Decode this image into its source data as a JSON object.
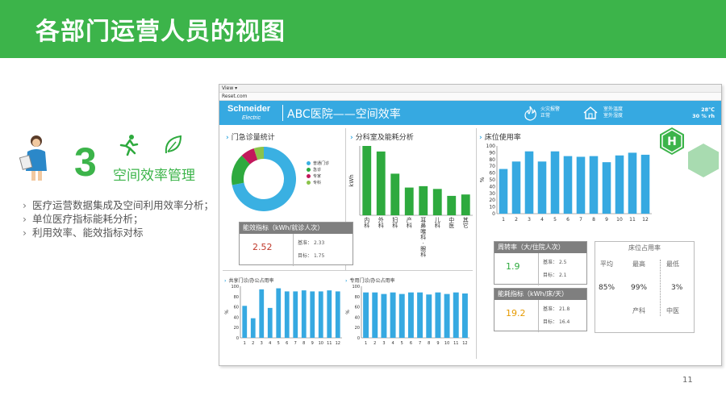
{
  "slide": {
    "title": "各部门运营人员的视图",
    "section_number": "3",
    "section_title": "空间效率管理",
    "bullets": [
      "医疗运营数据集成及空间利用效率分析；",
      "单位医疗指标能耗分析；",
      "利用效率、能效指标对标"
    ],
    "page_number": "11"
  },
  "browser": {
    "menu": "View ▾",
    "url": "Reset.com"
  },
  "app": {
    "logo": "Schneider",
    "logo_sub": "Electric",
    "title": "ABC医院——空间效率",
    "alarm_label": "火灾报警",
    "alarm_status": "正常",
    "indoor_temp_label": "室外温度",
    "indoor_hum_label": "室外湿度",
    "temp_value": "28℃",
    "hum_value": "30 % rh"
  },
  "panels": {
    "outpatient": {
      "title": "门急诊量统计",
      "legend": [
        {
          "label": "普通门诊",
          "color": "#3ab0e2"
        },
        {
          "label": "急诊",
          "color": "#2eaa3e"
        },
        {
          "label": "专家",
          "color": "#c2185b"
        },
        {
          "label": "专科",
          "color": "#8bc34a"
        }
      ],
      "kpi_title": "能效指标（kWh/就诊人次）",
      "kpi_value": "2.52",
      "kpi_base_label": "基准：",
      "kpi_base": "2.33",
      "kpi_target_label": "目标：",
      "kpi_target": "1.75"
    },
    "dept": {
      "title": "分科室及能耗分析"
    },
    "bed": {
      "title": "床位使用率",
      "turnover_title": "周转率（大/住院人次）",
      "turnover_value": "1.9",
      "turnover_base_label": "基准：",
      "turnover_base": "2.5",
      "turnover_target_label": "目标：",
      "turnover_target": "2.1",
      "energy_title": "能耗指标（kWh/床/天）",
      "energy_value": "19.2",
      "energy_base_label": "基准：",
      "energy_base": "21.8",
      "energy_target_label": "目标：",
      "energy_target": "16.4",
      "occ_title": "床位占用率",
      "occ_labels": [
        "平均",
        "最高",
        "最低"
      ],
      "occ_values": [
        "85%",
        "99%",
        "3%"
      ],
      "occ_depts": [
        "产科",
        "中医"
      ],
      "hospital_mark": "H"
    },
    "public": {
      "title": "共享门诊/办公占用率"
    },
    "dedicated": {
      "title": "专用门诊/办公占用率"
    }
  },
  "colors": {
    "banner": "#3cb44a",
    "accent": "#36a9e1",
    "bar_blue": "#36a9e1",
    "bar_green": "#2eaa3e",
    "kpi_red": "#c0392b",
    "kpi_green": "#2eaa3e",
    "kpi_orange": "#e69a00"
  },
  "chart_data": [
    {
      "id": "outpatient",
      "type": "pie",
      "title": "门急诊量统计",
      "categories": [
        "普通门诊",
        "急诊",
        "专家",
        "专科"
      ],
      "values": [
        72,
        16,
        7,
        5
      ]
    },
    {
      "id": "dept",
      "type": "bar",
      "title": "分科室及能耗分析",
      "ylabel": "kWh",
      "categories": [
        "内科",
        "外科",
        "妇科",
        "产科",
        "耳鼻喉科·眼科",
        "儿科",
        "中医",
        "其它"
      ],
      "values": [
        100,
        92,
        60,
        40,
        42,
        38,
        28,
        30
      ],
      "ylim": [
        0,
        100
      ]
    },
    {
      "id": "bed",
      "type": "bar",
      "title": "床位使用率",
      "ylabel": "%",
      "categories": [
        "1",
        "2",
        "3",
        "4",
        "5",
        "6",
        "7",
        "8",
        "9",
        "10",
        "11",
        "12"
      ],
      "values": [
        66,
        77,
        92,
        77,
        92,
        85,
        84,
        85,
        76,
        86,
        90,
        87
      ],
      "ylim": [
        0,
        100
      ],
      "yticks": [
        0,
        10,
        20,
        30,
        40,
        50,
        60,
        70,
        80,
        90,
        100
      ]
    },
    {
      "id": "public",
      "type": "bar",
      "title": "共享门诊/办公占用率",
      "ylabel": "%",
      "categories": [
        "1",
        "2",
        "3",
        "4",
        "5",
        "6",
        "7",
        "8",
        "9",
        "10",
        "11",
        "12"
      ],
      "values": [
        62,
        38,
        94,
        58,
        96,
        90,
        90,
        92,
        90,
        90,
        92,
        90
      ],
      "ylim": [
        0,
        100
      ],
      "yticks": [
        0,
        20,
        40,
        60,
        80,
        100
      ]
    },
    {
      "id": "dedicated",
      "type": "bar",
      "title": "专用门诊/办公占用率",
      "ylabel": "%",
      "categories": [
        "1",
        "2",
        "3",
        "4",
        "5",
        "6",
        "7",
        "8",
        "9",
        "10",
        "11",
        "12"
      ],
      "values": [
        88,
        88,
        85,
        88,
        85,
        88,
        88,
        84,
        88,
        85,
        88,
        86
      ],
      "ylim": [
        0,
        100
      ],
      "yticks": [
        0,
        20,
        40,
        60,
        80,
        100
      ]
    }
  ]
}
